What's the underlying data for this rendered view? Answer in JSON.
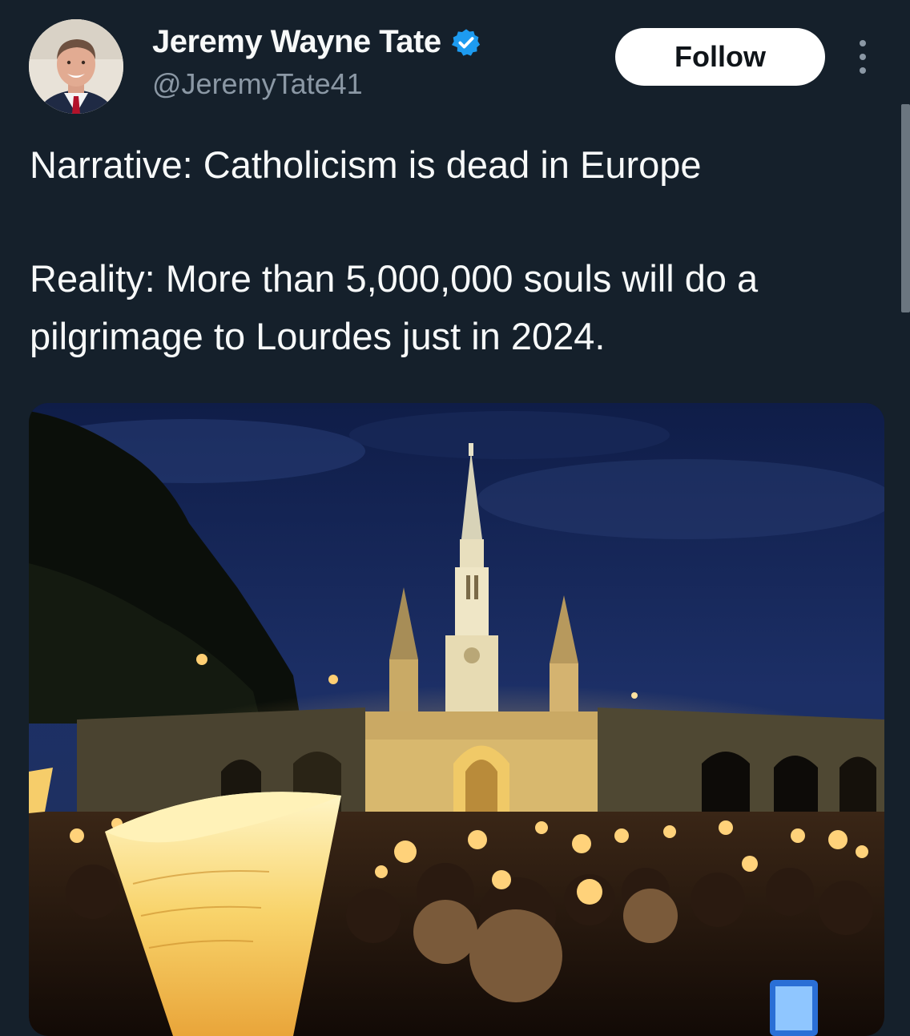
{
  "author": {
    "display_name": "Jeremy Wayne Tate",
    "handle": "@JeremyTate41",
    "verified": true
  },
  "actions": {
    "follow_label": "Follow"
  },
  "tweet": {
    "line_1": "Narrative: Catholicism is dead in Europe",
    "line_2": "Reality: More than 5,000,000 souls will do a pilgrimage to Lourdes just in 2024."
  },
  "colors": {
    "background": "#15202b",
    "text": "#f7f9f9",
    "secondary_text": "#8b98a5",
    "verified_blue": "#1d9bf0",
    "follow_button_bg": "#ffffff"
  },
  "icons": {
    "verified": "verified-badge-icon",
    "more": "more-options-icon"
  }
}
